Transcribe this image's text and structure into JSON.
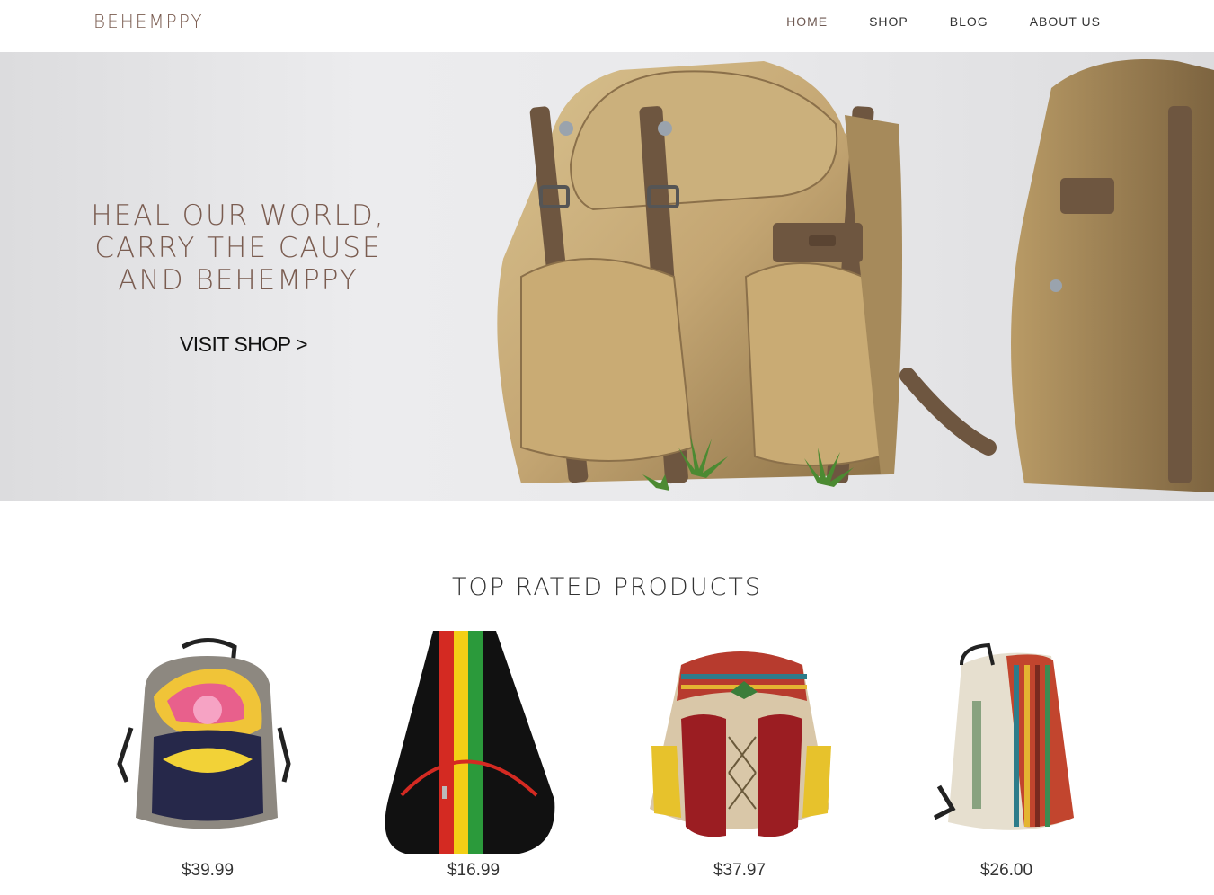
{
  "header": {
    "logo": "BEHEMPPY",
    "nav": [
      "HOME",
      "SHOP",
      "BLOG",
      "ABOUT US"
    ]
  },
  "hero": {
    "lines": [
      "HEAL OUR WORLD,",
      "CARRY THE CAUSE",
      "AND BEHEMPPY"
    ],
    "cta": "VISIT SHOP >"
  },
  "top_rated": {
    "title": "TOP RATED PRODUCTS",
    "products": [
      {
        "price": "$39.99"
      },
      {
        "price": "$16.99"
      },
      {
        "price": "$37.97"
      },
      {
        "price": "$26.00"
      }
    ]
  },
  "colors": {
    "brand": "#7a5c50",
    "text": "#333333",
    "canvas": "#c4a673"
  }
}
